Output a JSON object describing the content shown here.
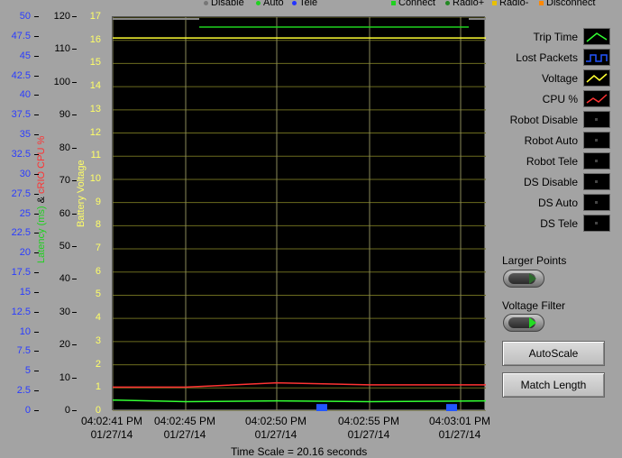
{
  "top_legend": {
    "disable": "Disable",
    "auto": "Auto",
    "tele": "Tele",
    "connect": "Connect",
    "radio_plus": "Radio+",
    "radio_minus": "Radio-",
    "disconnect": "Disconnect"
  },
  "axes": {
    "left1_ticks": [
      "50",
      "47.5",
      "45",
      "42.5",
      "40",
      "37.5",
      "35",
      "32.5",
      "30",
      "27.5",
      "25",
      "22.5",
      "20",
      "17.5",
      "15",
      "12.5",
      "10",
      "7.5",
      "5",
      "2.5",
      "0"
    ],
    "left2_ticks": [
      "120",
      "110",
      "100",
      "90",
      "80",
      "70",
      "60",
      "50",
      "40",
      "30",
      "20",
      "10",
      "0"
    ],
    "left3_ticks": [
      "17",
      "16",
      "15",
      "14",
      "13",
      "12",
      "11",
      "10",
      "9",
      "8",
      "7",
      "6",
      "5",
      "4",
      "3",
      "2",
      "1",
      "0"
    ],
    "label_cpu": "cRIO CPU %",
    "label_amp": "&",
    "label_trip": "Latency (ms)",
    "label_voltage": "Battery Voltage",
    "x_ticks": [
      {
        "time": "04:02:41 PM",
        "date": "01/27/14"
      },
      {
        "time": "04:02:45 PM",
        "date": "01/27/14"
      },
      {
        "time": "04:02:50 PM",
        "date": "01/27/14"
      },
      {
        "time": "04:02:55 PM",
        "date": "01/27/14"
      },
      {
        "time": "04:03:01 PM",
        "date": "01/27/14"
      }
    ],
    "x_title": "Time Scale = 20.16 seconds"
  },
  "legend": [
    {
      "label": "Trip Time",
      "icon": "trip-time-swatch",
      "color": "#33ff33"
    },
    {
      "label": "Lost Packets",
      "icon": "lost-packets-swatch",
      "color": "#2255ff"
    },
    {
      "label": "Voltage",
      "icon": "voltage-swatch",
      "color": "#ffff33"
    },
    {
      "label": "CPU %",
      "icon": "cpu-swatch",
      "color": "#ff3333"
    },
    {
      "label": "Robot Disable",
      "icon": "robot-disable-swatch",
      "color": "#444444"
    },
    {
      "label": "Robot Auto",
      "icon": "robot-auto-swatch",
      "color": "#444444"
    },
    {
      "label": "Robot Tele",
      "icon": "robot-tele-swatch",
      "color": "#444444"
    },
    {
      "label": "DS Disable",
      "icon": "ds-disable-swatch",
      "color": "#444444"
    },
    {
      "label": "DS Auto",
      "icon": "ds-auto-swatch",
      "color": "#444444"
    },
    {
      "label": "DS Tele",
      "icon": "ds-tele-swatch",
      "color": "#444444"
    }
  ],
  "controls": {
    "larger_points_label": "Larger Points",
    "voltage_filter_label": "Voltage Filter",
    "autoscale_label": "AutoScale",
    "match_length_label": "Match Length"
  },
  "chart_data": {
    "type": "line",
    "x": [
      "04:02:41 PM",
      "04:02:45 PM",
      "04:02:50 PM",
      "04:02:55 PM",
      "04:03:01 PM"
    ],
    "x_label": "Time Scale = 20.16 seconds",
    "y_axes": [
      {
        "name": "Latency (ms)",
        "range": [
          0,
          50
        ],
        "color": "#2a3cff"
      },
      {
        "name": "cRIO CPU %",
        "range": [
          0,
          120
        ],
        "color": "#ff3333"
      },
      {
        "name": "Battery Voltage",
        "range": [
          0,
          17
        ],
        "color": "#ffff66"
      }
    ],
    "series": [
      {
        "name": "Voltage",
        "color": "#ffff33",
        "values": [
          16.1,
          16.1,
          16.1,
          16.1,
          16.1
        ]
      },
      {
        "name": "Trip Time",
        "color": "#33ff33",
        "values": [
          1.4,
          1.2,
          1.3,
          1.2,
          1.3
        ]
      },
      {
        "name": "CPU %",
        "color": "#ff3333",
        "values": [
          7.3,
          7.3,
          8.6,
          8.0,
          8.0
        ]
      },
      {
        "name": "Lost Packets",
        "color": "#2255ff",
        "values": [
          0,
          0,
          0.9,
          0,
          0.9
        ]
      }
    ],
    "grid": true
  }
}
